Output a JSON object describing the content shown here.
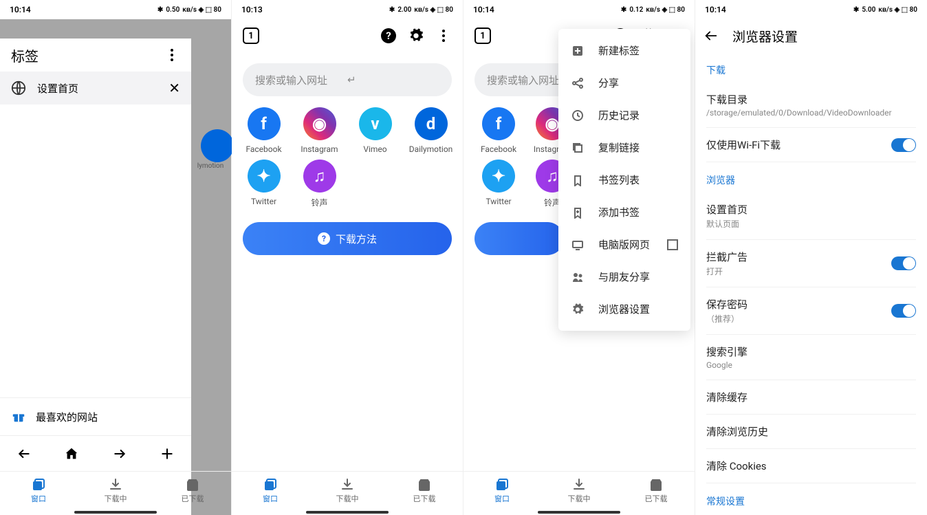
{
  "status": {
    "time1": "10:14",
    "time2": "10:13",
    "time3": "10:14",
    "time4": "10:14",
    "bt": "✱",
    "kbs1": "0.50",
    "kbs2": "2.00",
    "kbs3": "0.12",
    "kbs4": "5.00",
    "kbsu": "KB/s",
    "wifi": "◈",
    "batt": "80"
  },
  "screen1": {
    "title": "标签",
    "tab_label": "设置首页",
    "fav": "最喜欢的网站"
  },
  "browser": {
    "search_ph": "搜索或输入网址",
    "sites": [
      {
        "k": "fb",
        "label": "Facebook",
        "g": "f"
      },
      {
        "k": "ig",
        "label": "Instagram",
        "g": "◉"
      },
      {
        "k": "vm",
        "label": "Vimeo",
        "g": "v"
      },
      {
        "k": "dm",
        "label": "Dailymotion",
        "g": "d"
      },
      {
        "k": "tw",
        "label": "Twitter",
        "g": "✦"
      },
      {
        "k": "rt",
        "label": "铃声",
        "g": "♫"
      }
    ],
    "dl": "下载方法",
    "tabcount": "1"
  },
  "bottomnav": {
    "a": "窗口",
    "b": "下载中",
    "c": "已下载"
  },
  "menu": {
    "items": [
      "新建标签",
      "分享",
      "历史记录",
      "复制链接",
      "书签列表",
      "添加书签",
      "电脑版网页",
      "与朋友分享",
      "浏览器设置"
    ]
  },
  "settings": {
    "title": "浏览器设置",
    "sect_dl": "下载",
    "dldir": "下载目录",
    "dlpath": "/storage/emulated/0/Download/VideoDownloader",
    "wifionly": "仅使用Wi-Fi下载",
    "sect_br": "浏览器",
    "home": "设置首页",
    "home_sub": "默认页面",
    "adblock": "拦截广告",
    "adblock_sub": "打开",
    "savepw": "保存密码",
    "savepw_sub": "（推荐）",
    "engine": "搜索引擎",
    "engine_sub": "Google",
    "clearcache": "清除缓存",
    "clearhist": "清除浏览历史",
    "clearck": "清除 Cookies",
    "sect_gen": "常规设置"
  }
}
